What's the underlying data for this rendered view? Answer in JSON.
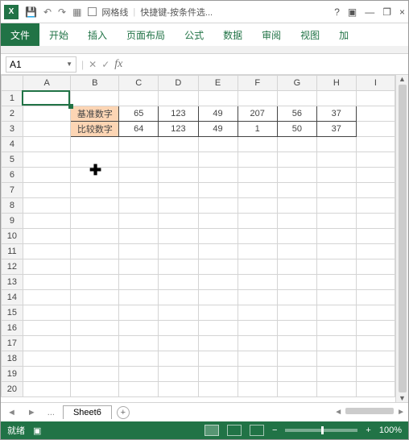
{
  "titlebar": {
    "app_badge": "X",
    "gridlines_label": "网格线",
    "doc_title": "快捷键-按条件选...",
    "help": "?",
    "ribbon_toggle": "▣",
    "minimize": "—",
    "restore": "❐",
    "close": "×"
  },
  "ribbon": {
    "file": "文件",
    "tabs": [
      "开始",
      "插入",
      "页面布局",
      "公式",
      "数据",
      "审阅",
      "视图",
      "加"
    ]
  },
  "namebox": {
    "value": "A1"
  },
  "fx": {
    "cancel": "✕",
    "confirm": "✓",
    "fx": "fx"
  },
  "columns": [
    "A",
    "B",
    "C",
    "D",
    "E",
    "F",
    "G",
    "H",
    "I"
  ],
  "row_count": 20,
  "data_rows": [
    {
      "label": "基准数字",
      "values": [
        65,
        123,
        49,
        207,
        56,
        37
      ]
    },
    {
      "label": "比较数字",
      "values": [
        64,
        123,
        49,
        1,
        50,
        37
      ]
    }
  ],
  "active_cell": {
    "row": 1,
    "col": "A"
  },
  "sheet_tabs": {
    "dots": "...",
    "active": "Sheet6",
    "add": "+"
  },
  "statusbar": {
    "ready": "就绪",
    "zoom_in": "+",
    "zoom_out": "−",
    "zoom": "100%"
  }
}
